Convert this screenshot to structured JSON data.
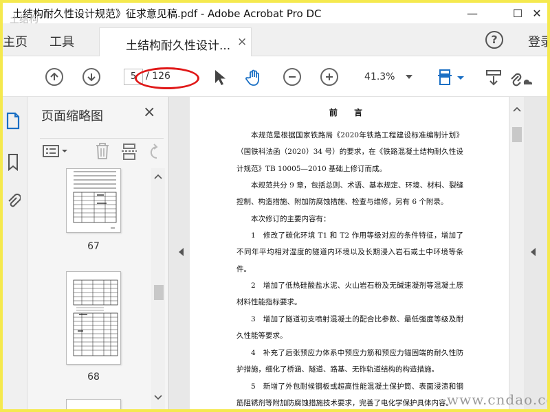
{
  "window": {
    "title": "土结构耐久性设计规范》征求意见稿.pdf - Adobe Acrobat Pro DC",
    "minimize": "—",
    "maximize": "☐",
    "close": "✕"
  },
  "tabs": {
    "home": "主页",
    "tools": "工具",
    "document": "土结构耐久性设计...",
    "document_close": "×",
    "help": "?",
    "login": "登录"
  },
  "toolbar": {
    "current_page": "5",
    "total_pages": "/ 126",
    "zoom": "41.3%",
    "highlight_color": "#e01818"
  },
  "thumbnails": {
    "title": "页面缩略图",
    "close": "×",
    "pages": [
      "67",
      "68"
    ]
  },
  "document": {
    "heading": "前 言",
    "paragraphs": [
      "本规范是根据国家铁路局《2020年铁路工程建设标准编制计划》（国铁科法函（2020）34 号）的要求，在《铁路混凝土结构耐久性设计规范》TB 10005—2010 基础上修订而成。",
      "本规范共分 9 章，包括总则、术语、基本规定、环境、材料、裂缝控制、构造措施、附加防腐蚀措施、检查与维修，另有 6 个附录。",
      "本次修订的主要内容有：",
      "1　修改了碳化环境 T1 和 T2 作用等级对应的条件特征，增加了不同年平均相对湿度的隧道内环境以及长期浸入岩石或土中环境等条件。",
      "2　增加了低热硅酸盐水泥、火山岩石粉及无碱速凝剂等混凝土原材料性能指标要求。",
      "3　增加了隧道初支喷射混凝土的配合比参数、最低强度等级及耐久性能等要求。",
      "4　补充了后张预应力体系中预应力筋和预应力锚固端的耐久性防护措施，细化了桥涵、隧道、路基、无砟轨道结构的构造措施。",
      "5　新增了外包耐候钢板或超高性能混凝土保护筒、表面浸渍和钢筋阻锈剂等附加防腐蚀措施技术要求，完善了电化学保护具体内容。"
    ]
  },
  "watermark": "www.cndao.com",
  "watermark_tl": "土结构"
}
